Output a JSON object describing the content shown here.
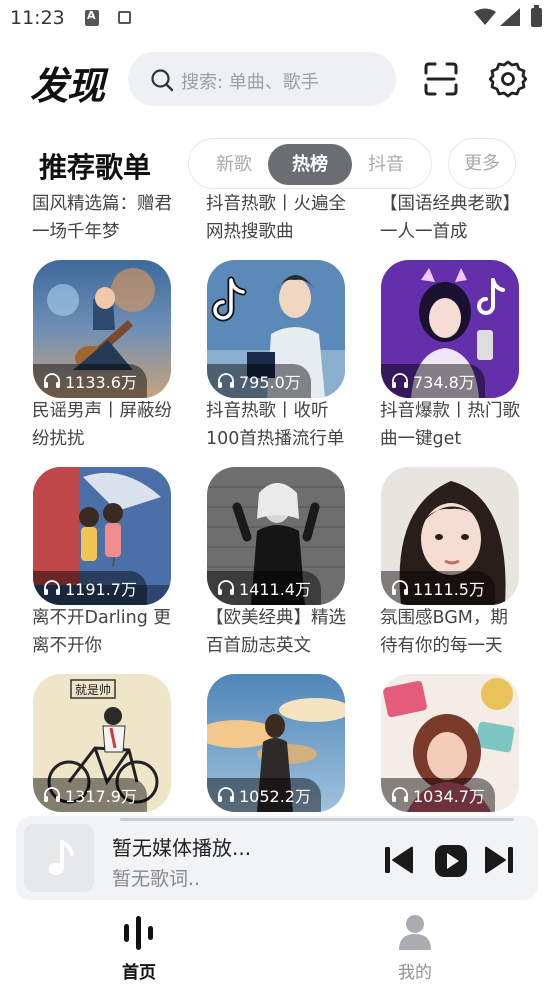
{
  "status_bar": {
    "time": "11:23"
  },
  "header": {
    "title": "发现",
    "search_placeholder": "搜索: 单曲、歌手"
  },
  "section": {
    "title": "推荐歌单",
    "tabs": [
      "新歌",
      "热榜",
      "抖音"
    ],
    "active_tab": "热榜",
    "more_label": "更多"
  },
  "top_captions": [
    "国风精选篇：赠君一场千年梦",
    "抖音热歌丨火遍全网热搜歌曲",
    "【国语经典老歌】一人一首成"
  ],
  "playlists": [
    {
      "plays": "1133.6万",
      "title": "民谣男声丨屏蔽纷纷扰扰",
      "art": "anime-guitar"
    },
    {
      "plays": "795.0万",
      "title": "抖音热歌丨收听100首热播流行单",
      "art": "tiktok-boy"
    },
    {
      "plays": "734.8万",
      "title": "抖音爆款丨热门歌曲一键get",
      "art": "tiktok-girl-headphones"
    },
    {
      "plays": "1191.7万",
      "title": "离不开Darling 更离不开你",
      "art": "couple-umbrella"
    },
    {
      "plays": "1411.4万",
      "title": "【欧美经典】精选百首励志英文",
      "art": "bw-woman-wall"
    },
    {
      "plays": "1111.5万",
      "title": "氛围感BGM，期待有你的每一天",
      "art": "girl-portrait"
    },
    {
      "plays": "1317.9万",
      "title": "",
      "art": "boy-bicycle"
    },
    {
      "plays": "1052.2万",
      "title": "",
      "art": "woman-sky"
    },
    {
      "plays": "1034.7万",
      "title": "",
      "art": "girl-stickers"
    }
  ],
  "cover_sticker_text": "就是帅",
  "player": {
    "title": "暂无媒体播放...",
    "lyric": "暂无歌词.."
  },
  "nav": {
    "home_label": "首页",
    "mine_label": "我的"
  },
  "colors": {
    "active_tab_bg": "#6a6e72",
    "accent_text": "#111111",
    "muted_text": "#a7abb1"
  }
}
